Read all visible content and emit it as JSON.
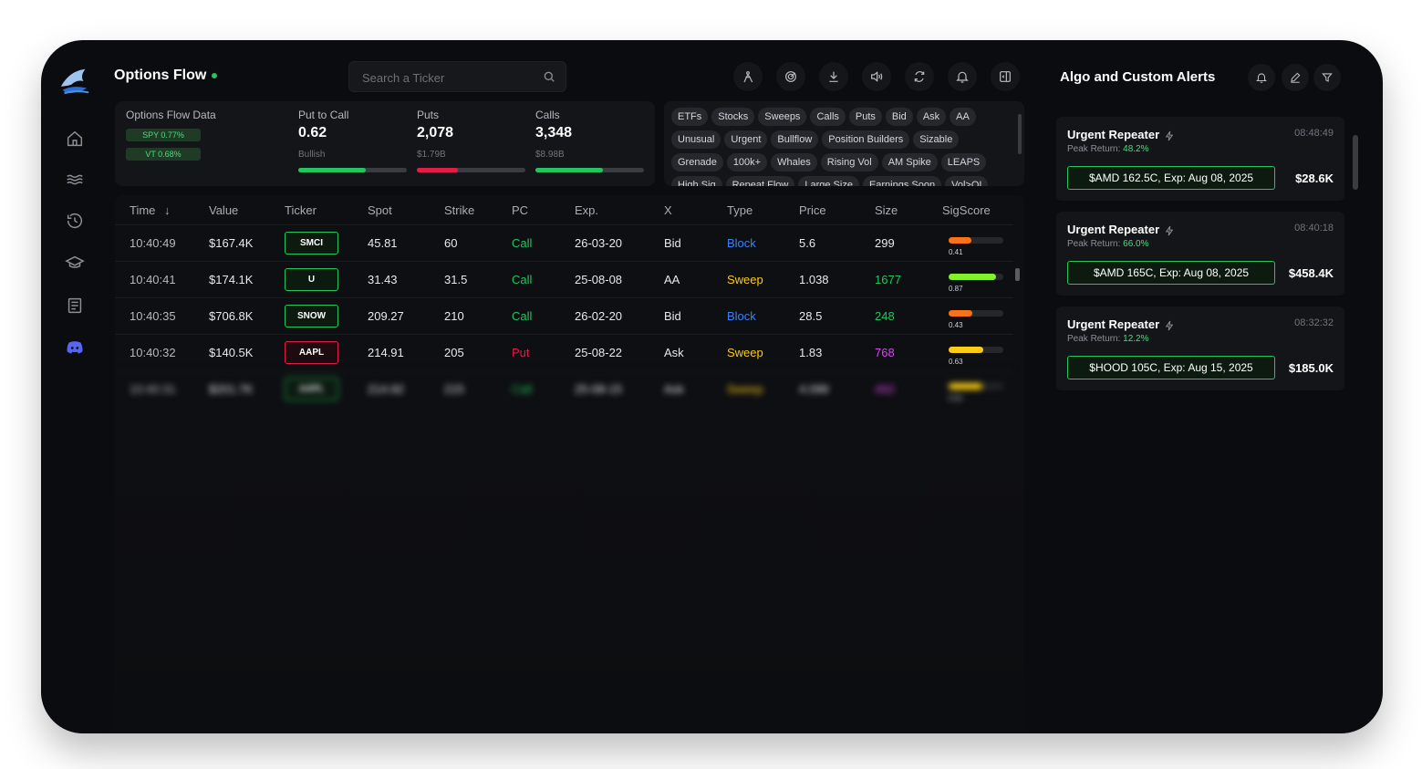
{
  "app": {
    "title": "Options Flow",
    "alerts_title": "Algo and Custom Alerts"
  },
  "search": {
    "placeholder": "Search a Ticker"
  },
  "toolbar": [
    "person-icon",
    "radar-icon",
    "download-icon",
    "volume-icon",
    "refresh-icon",
    "bell-icon",
    "panel-icon"
  ],
  "sidebar": [
    "home-icon",
    "waves-icon",
    "history-icon",
    "graduation-cap-icon",
    "news-icon",
    "discord-icon"
  ],
  "stats": {
    "label": "Options Flow Data",
    "spy": "SPY 0.77%",
    "vt": "VT 0.68%",
    "put_call_label": "Put to Call",
    "put_call_value": "0.62",
    "put_call_sub": "Bullish",
    "put_call_pct": 0.62,
    "puts_label": "Puts",
    "puts_value": "2,078",
    "puts_sub": "$1.79B",
    "puts_pct": 0.38,
    "calls_label": "Calls",
    "calls_value": "3,348",
    "calls_sub": "$8.98B",
    "calls_pct": 0.62
  },
  "chips": [
    "ETFs",
    "Stocks",
    "Sweeps",
    "Calls",
    "Puts",
    "Bid",
    "Ask",
    "AA",
    "Unusual",
    "Urgent",
    "Bullflow",
    "Position Builders",
    "Sizable",
    "Grenade",
    "100k+",
    "Whales",
    "Rising Vol",
    "AM Spike",
    "LEAPS",
    "High Sig",
    "Repeat Flow",
    "Large Size",
    "Earnings Soon",
    "Vol>OI"
  ],
  "columns": {
    "time": "Time",
    "value": "Value",
    "ticker": "Ticker",
    "spot": "Spot",
    "strike": "Strike",
    "pc": "PC",
    "exp": "Exp.",
    "x": "X",
    "type": "Type",
    "price": "Price",
    "size": "Size",
    "sig": "SigScore"
  },
  "rows": [
    {
      "time": "10:40:49",
      "value": "$167.4K",
      "ticker": "SMCI",
      "spot": "45.81",
      "strike": "60",
      "pc": "Call",
      "exp": "26-03-20",
      "x": "Bid",
      "type": "Block",
      "price": "5.6",
      "size": "299",
      "sig": "0.41",
      "sig_val": 0.41
    },
    {
      "time": "10:40:41",
      "value": "$174.1K",
      "ticker": "U",
      "spot": "31.43",
      "strike": "31.5",
      "pc": "Call",
      "exp": "25-08-08",
      "x": "AA",
      "type": "Sweep",
      "price": "1.038",
      "size": "1677",
      "sig": "0.87",
      "sig_val": 0.87
    },
    {
      "time": "10:40:35",
      "value": "$706.8K",
      "ticker": "SNOW",
      "spot": "209.27",
      "strike": "210",
      "pc": "Call",
      "exp": "26-02-20",
      "x": "Bid",
      "type": "Block",
      "price": "28.5",
      "size": "248",
      "sig": "0.43",
      "sig_val": 0.43
    },
    {
      "time": "10:40:32",
      "value": "$140.5K",
      "ticker": "AAPL",
      "spot": "214.91",
      "strike": "205",
      "pc": "Put",
      "exp": "25-08-22",
      "x": "Ask",
      "type": "Sweep",
      "price": "1.83",
      "size": "768",
      "sig": "0.63",
      "sig_val": 0.63
    },
    {
      "time": "10:40:31",
      "value": "$201.7K",
      "ticker": "AAPL",
      "spot": "214.92",
      "strike": "215",
      "pc": "Call",
      "exp": "25-08-15",
      "x": "Ask",
      "type": "Sweep",
      "price": "4.099",
      "size": "492",
      "sig": "0.61",
      "sig_val": 0.61
    }
  ],
  "alerts": [
    {
      "title": "Urgent Repeater",
      "time": "08:48:49",
      "peak_label": "Peak Return: ",
      "peak": "48.2%",
      "contract": "$AMD 162.5C, Exp: Aug 08, 2025",
      "value": "$28.6K"
    },
    {
      "title": "Urgent Repeater",
      "time": "08:40:18",
      "peak_label": "Peak Return: ",
      "peak": "66.0%",
      "contract": "$AMD 165C, Exp: Aug 08, 2025",
      "value": "$458.4K"
    },
    {
      "title": "Urgent Repeater",
      "time": "08:32:32",
      "peak_label": "Peak Return: ",
      "peak": "12.2%",
      "contract": "$HOOD 105C, Exp: Aug 15, 2025",
      "value": "$185.0K"
    }
  ],
  "colors": {
    "call": "#22c55e",
    "put": "#e11d48",
    "block": "#3b82f6",
    "sweep": "#facc15",
    "size_green": "#22c55e",
    "size_pink": "#d946ef",
    "discord": "#5865f2"
  }
}
